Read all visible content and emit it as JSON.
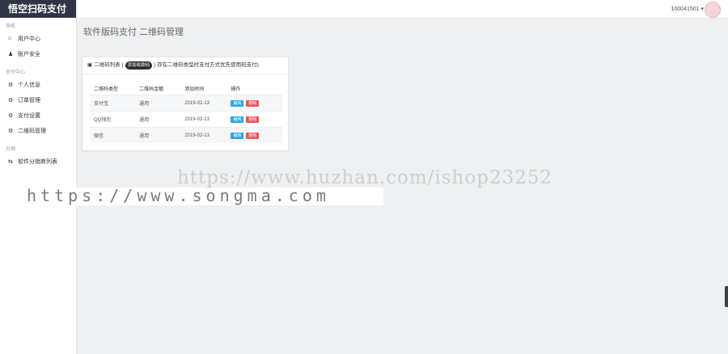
{
  "brand": "悟空扫码支付",
  "sidebar": {
    "groups": [
      {
        "title": "导航",
        "items": [
          {
            "icon": "home-icon",
            "glyph": "⌂",
            "label": "用户中心"
          },
          {
            "icon": "user-icon",
            "glyph": "♟",
            "label": "账户安全"
          }
        ]
      },
      {
        "title": "支付中心",
        "items": [
          {
            "icon": "gear-icon",
            "glyph": "⚙",
            "label": "个人信息"
          },
          {
            "icon": "gear-icon",
            "glyph": "⚙",
            "label": "订单管理"
          },
          {
            "icon": "gear-icon",
            "glyph": "⚙",
            "label": "支付设置"
          },
          {
            "icon": "gear-icon",
            "glyph": "⚙",
            "label": "二维码管理"
          }
        ]
      },
      {
        "title": "分销",
        "items": [
          {
            "icon": "share-icon",
            "glyph": "⇆",
            "label": "软件分销商列表"
          }
        ]
      }
    ]
  },
  "topbar": {
    "user": "100041501 ▾"
  },
  "page_title": "软件版码支付 二维码管理",
  "card": {
    "title_prefix": "二维码列表 (",
    "pill": "添加收款码",
    "title_suffix": ") 存在二维码类型时支付方式优先使用码支付)",
    "columns": [
      "二维码类型",
      "二维码金额",
      "添加时间",
      "操作"
    ],
    "rows": [
      {
        "type": "支付宝",
        "amount": "通用",
        "date": "2019-02-13",
        "edit": "编辑",
        "del": "删除"
      },
      {
        "type": "QQ钱包",
        "amount": "通用",
        "date": "2019-02-13",
        "edit": "编辑",
        "del": "删除"
      },
      {
        "type": "微信",
        "amount": "通用",
        "date": "2019-02-13",
        "edit": "编辑",
        "del": "删除"
      }
    ]
  },
  "watermarks": {
    "top": "https://www.huzhan.com/ishop23252",
    "bottom": "https://www.songma.com"
  }
}
